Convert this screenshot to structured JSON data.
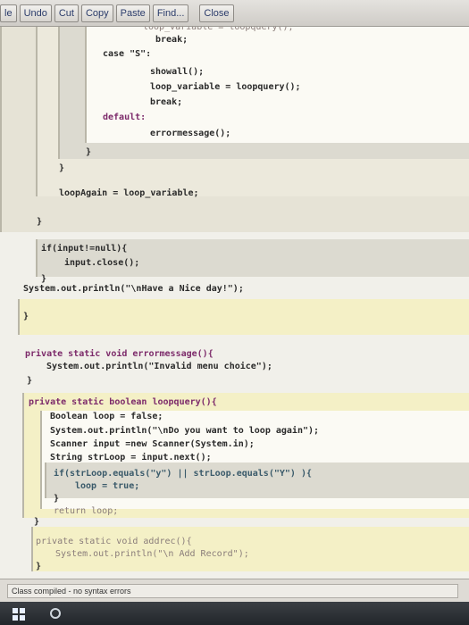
{
  "toolbar": {
    "buttons": [
      "le",
      "Undo",
      "Cut",
      "Copy",
      "Paste",
      "Find...",
      "Close"
    ]
  },
  "code": {
    "lines": [
      "loop_variable = loopquery();",
      "break;",
      "case \"S\":",
      "showall();",
      "loop_variable = loopquery();",
      "break;",
      "default:",
      "errormessage();",
      "}",
      "}",
      "loopAgain = loop_variable;",
      "}",
      "if(input!=null){",
      "input.close();",
      "}",
      "System.out.println(\"\\nHave a Nice day!\");",
      "}",
      "private static void errormessage(){",
      "System.out.println(\"Invalid menu choice\");",
      "}",
      "private static boolean loopquery(){",
      "Boolean loop = false;",
      "System.out.println(\"\\nDo you want to loop again\");",
      "Scanner input =new Scanner(System.in);",
      "String strLoop = input.next();",
      "if(strLoop.equals(\"y\") || strLoop.equals(\"Y\") ){",
      "loop = true;",
      "}",
      "return loop;",
      "}",
      "private static void addrec(){",
      "System.out.println(\"\\n Add Record\");",
      "}"
    ]
  },
  "status": {
    "message": "Class compiled - no syntax errors"
  },
  "colors": {
    "block_yellow": "#f4f0c6",
    "block_white": "#fbfaf4",
    "block_gray": "#dcdad0",
    "block_beige": "#ece9dc"
  }
}
